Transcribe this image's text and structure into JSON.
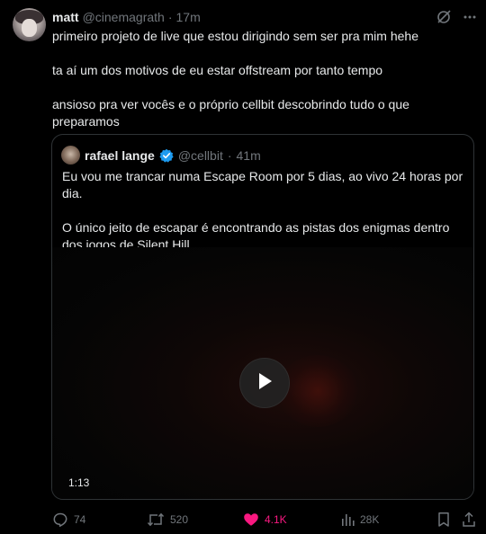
{
  "post": {
    "author_name": "matt",
    "author_handle": "@cinemagrath",
    "separator": "·",
    "time": "17m",
    "paragraphs": [
      "primeiro projeto de live que estou dirigindo sem ser pra mim hehe",
      "ta aí um dos motivos de eu estar offstream por tanto tempo",
      "ansioso pra ver vocês e o próprio cellbit descobrindo tudo o que preparamos"
    ]
  },
  "quote": {
    "author_name": "rafael lange",
    "author_handle": "@cellbit",
    "separator": "·",
    "time": "41m",
    "paragraphs": [
      "Eu vou me trancar numa Escape Room por 5 dias, ao vivo 24 horas por dia.",
      "O único jeito de escapar é encontrando as pistas dos enigmas dentro dos jogos de Silent Hill..."
    ],
    "video_duration": "1:13"
  },
  "actions": {
    "replies": "74",
    "reposts": "520",
    "likes": "4.1K",
    "views": "28K"
  },
  "colors": {
    "background": "#000000",
    "text": "#e7e9ea",
    "muted": "#71767b",
    "like": "#f91880",
    "verified": "#1d9bf0",
    "border": "#2f3336"
  },
  "icons": [
    "grok-icon",
    "more-icon",
    "verified-icon",
    "play-icon",
    "reply-icon",
    "repost-icon",
    "like-icon",
    "views-icon",
    "bookmark-icon",
    "share-icon"
  ]
}
